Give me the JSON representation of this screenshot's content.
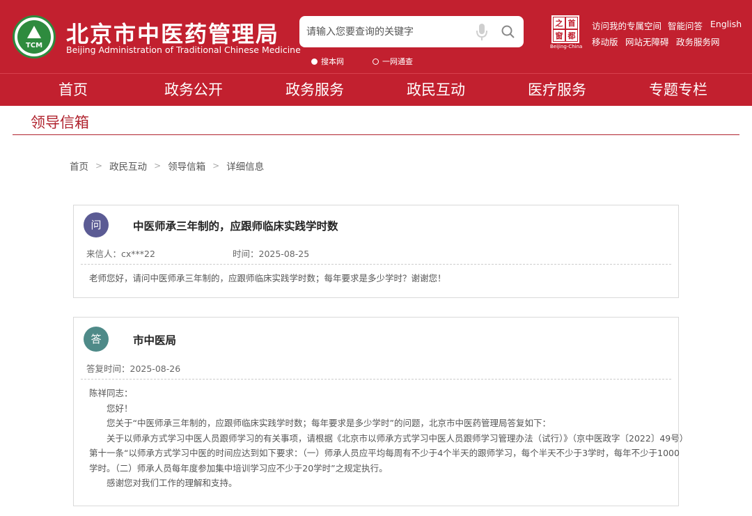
{
  "header": {
    "title_cn": "北京市中医药管理局",
    "title_en": "Beijing Administration of Traditional Chinese Medicine",
    "logo_text": "TCM",
    "search_placeholder": "请输入您要查询的关键字",
    "radio_options": [
      "搜本网",
      "一网通查"
    ],
    "capital_logo_chars": [
      "之",
      "首",
      "窗",
      "都"
    ],
    "capital_caption": "Beijing-China",
    "top_links_row1": [
      "访问我的专属空间",
      "智能问答",
      "English"
    ],
    "top_links_row2": [
      "移动版",
      "网站无障碍",
      "政务服务网"
    ],
    "icons": {
      "mic": "mic-icon",
      "search": "search-icon"
    }
  },
  "nav": {
    "items": [
      "首页",
      "政务公开",
      "政务服务",
      "政民互动",
      "医疗服务",
      "专题专栏"
    ]
  },
  "section": {
    "title": "领导信箱"
  },
  "breadcrumb": {
    "items": [
      "首页",
      "政民互动",
      "领导信箱",
      "详细信息"
    ],
    "separator": ">"
  },
  "question": {
    "badge": "问",
    "title": "中医师承三年制的，应跟师临床实践学时数",
    "sender": "来信人：cx***22",
    "time": "时间：2025-08-25",
    "content": "老师您好，请问中医师承三年制的，应跟师临床实践学时数；每年要求是多少学时？谢谢您！"
  },
  "answer": {
    "badge": "答",
    "title": "市中医局",
    "reply_time": "答复时间：2025-08-26",
    "lines": [
      "陈祥同志：",
      "　　您好！",
      "　　您关于“中医师承三年制的，应跟师临床实践学时数；每年要求是多少学时”的问题，北京市中医药管理局答复如下：",
      "　　关于以师承方式学习中医人员跟师学习的有关事项，请根据《北京市以师承方式学习中医人员跟师学习管理办法（试行）》（京中医政字〔2022〕49号）",
      "第十一条“以师承方式学习中医的时间应达到如下要求：（一）师承人员应平均每周有不少于4个半天的跟师学习，每个半天不少于3学时，每年不少于1000",
      "学时。（二）师承人员每年度参加集中培训学习应不少于20学时”之规定执行。",
      "　　感谢您对我们工作的理解和支持。"
    ]
  }
}
